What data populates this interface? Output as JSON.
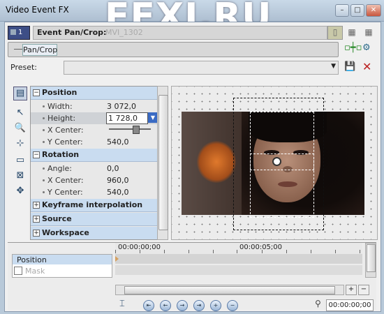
{
  "window": {
    "title": "Video Event FX",
    "watermark": "EFXI.RU"
  },
  "toolbar": {
    "track_number": "1",
    "plugin_label": "Event Pan/Crop:",
    "clip_name": "MVI_1302"
  },
  "chain": {
    "node_label": "Pan/Crop"
  },
  "preset": {
    "label": "Preset:",
    "value": ""
  },
  "properties": {
    "position": {
      "header": "Position",
      "width_label": "Width:",
      "width_value": "3 072,0",
      "height_label": "Height:",
      "height_value": "1 728,0",
      "xcenter_label": "X Center:",
      "ycenter_label": "Y Center:",
      "ycenter_value": "540,0"
    },
    "rotation": {
      "header": "Rotation",
      "angle_label": "Angle:",
      "angle_value": "0,0",
      "xcenter_label": "X Center:",
      "xcenter_value": "960,0",
      "ycenter_label": "Y Center:",
      "ycenter_value": "540,0"
    },
    "keyframe_header": "Keyframe interpolation",
    "source_header": "Source",
    "workspace_header": "Workspace"
  },
  "timeline": {
    "tracks": [
      "Position",
      "Mask"
    ],
    "ruler_start": "00:00:00;00",
    "ruler_mid": "00:00:05;00",
    "timecode": "00:00:00;00"
  }
}
